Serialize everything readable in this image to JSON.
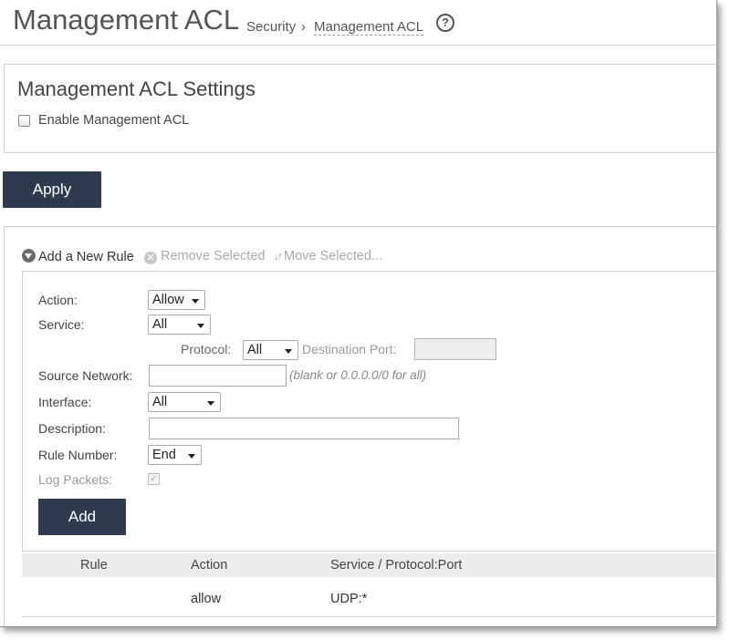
{
  "header": {
    "title": "Management ACL",
    "breadcrumb_section": "Security",
    "breadcrumb_separator": "›",
    "breadcrumb_current": "Management ACL",
    "help_icon_glyph": "?"
  },
  "settings": {
    "title": "Management ACL Settings",
    "enable_label": "Enable Management ACL",
    "enable_checked": false,
    "apply_label": "Apply"
  },
  "toolbar": {
    "add_rule_label": "Add a New Rule",
    "remove_label": "Remove Selected",
    "move_label": "Move Selected..."
  },
  "form": {
    "action_label": "Action:",
    "action_value": "Allow",
    "service_label": "Service:",
    "service_value": "All",
    "protocol_label": "Protocol:",
    "protocol_value": "All",
    "dest_port_label": "Destination Port:",
    "dest_port_value": "",
    "source_network_label": "Source Network:",
    "source_network_value": "",
    "source_network_hint": "(blank or 0.0.0.0/0 for all)",
    "interface_label": "Interface:",
    "interface_value": "All",
    "description_label": "Description:",
    "description_value": "",
    "rule_number_label": "Rule Number:",
    "rule_number_value": "End",
    "log_packets_label": "Log Packets:",
    "log_packets_checked": true,
    "add_label": "Add"
  },
  "table": {
    "columns": [
      "Rule",
      "Action",
      "Service / Protocol:Port"
    ],
    "rows": [
      {
        "rule": "",
        "action": "allow",
        "service": "UDP:*"
      }
    ]
  },
  "colors": {
    "button_bg": "#2e3b4e",
    "table_header_bg": "#ececec"
  }
}
